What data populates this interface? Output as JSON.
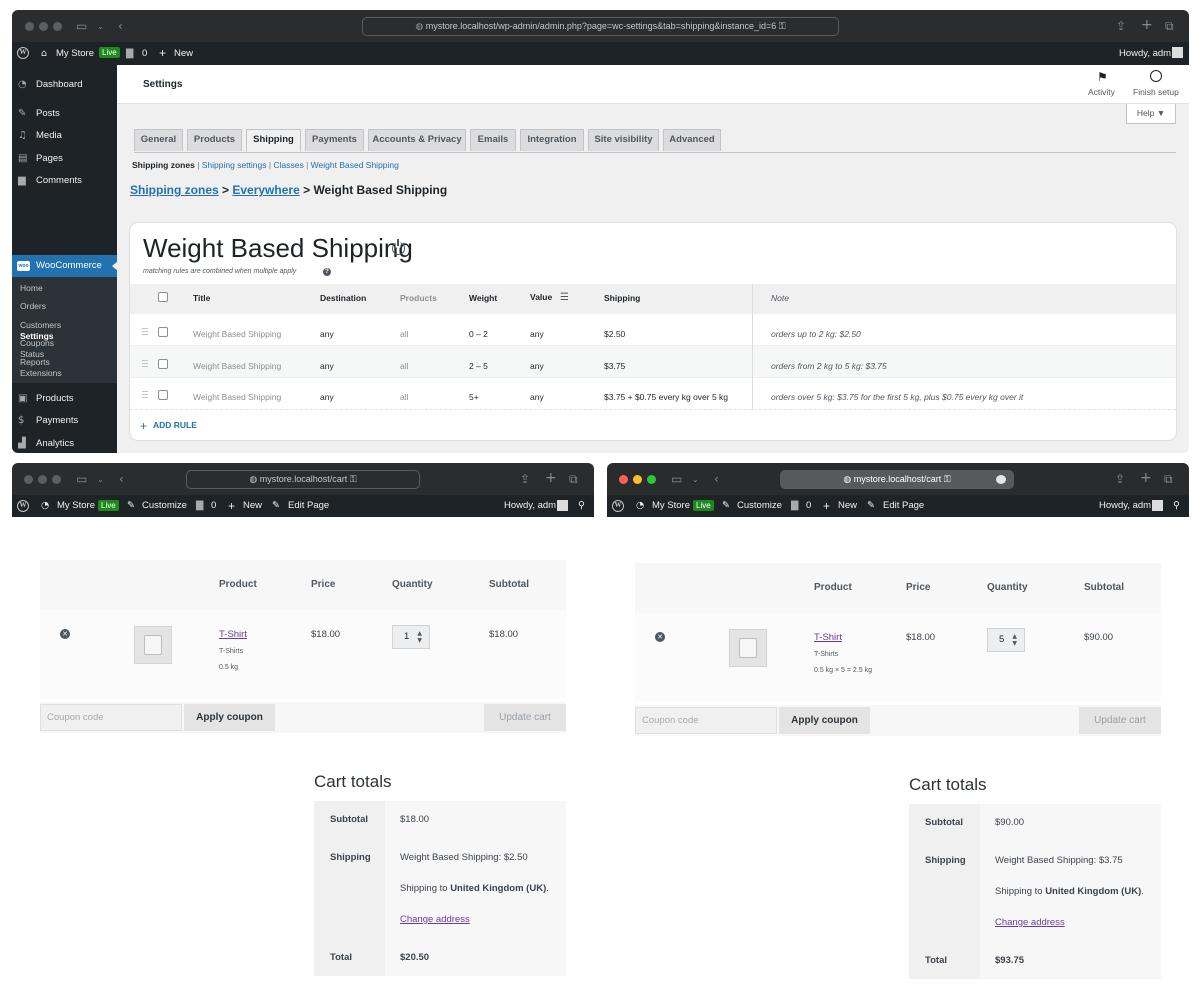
{
  "top": {
    "url": "mystore.localhost/wp-admin/admin.php?page=wc-settings&tab=shipping&instance_id=6",
    "admin_bar": {
      "site": "My Store",
      "live": "Live",
      "comments": "0",
      "new": "New",
      "howdy": "Howdy, adm"
    },
    "sidebar": {
      "items": [
        "Dashboard",
        "Posts",
        "Media",
        "Pages",
        "Comments"
      ],
      "woocommerce": "WooCommerce",
      "sub": [
        "Home",
        "Orders",
        "Customers",
        "Coupons",
        "Reports",
        "Settings",
        "Status",
        "Extensions"
      ],
      "bottom": [
        "Products",
        "Payments",
        "Analytics"
      ]
    },
    "header": {
      "title": "Settings",
      "activity": "Activity",
      "finish": "Finish setup",
      "help": "Help ▼"
    },
    "tabs": [
      "General",
      "Products",
      "Shipping",
      "Payments",
      "Accounts & Privacy",
      "Emails",
      "Integration",
      "Site visibility",
      "Advanced"
    ],
    "subnav": {
      "zones": "Shipping zones",
      "settings": "Shipping settings",
      "classes": "Classes",
      "wbs": "Weight Based Shipping"
    },
    "breadcrumb": {
      "zones": "Shipping zones",
      "everywhere": "Everywhere",
      "current": "Weight Based Shipping"
    },
    "panel": {
      "title": "Weight Based Shipping",
      "hint": "matching rules are combined when multiple apply",
      "columns": [
        "Title",
        "Destination",
        "Products",
        "Weight",
        "Value",
        "Shipping",
        "Note"
      ],
      "rows": [
        {
          "title": "Weight Based Shipping",
          "destination": "any",
          "products": "all",
          "weight": "0 – 2",
          "value": "any",
          "shipping": "$2.50",
          "note": "orders up to 2 kg: $2.50"
        },
        {
          "title": "Weight Based Shipping",
          "destination": "any",
          "products": "all",
          "weight": "2 – 5",
          "value": "any",
          "shipping": "$3.75",
          "note": "orders from 2 kg to 5 kg: $3.75"
        },
        {
          "title": "Weight Based Shipping",
          "destination": "any",
          "products": "all",
          "weight": "5+",
          "value": "any",
          "shipping": "$3.75 + $0.75 every kg over 5 kg",
          "note": "orders over 5 kg: $3.75 for the first 5 kg, plus $0.75 every kg over it"
        }
      ],
      "add_rule": "ADD RULE"
    }
  },
  "carts": [
    {
      "url": "mystore.localhost/cart",
      "bar": {
        "site": "My Store",
        "live": "Live",
        "customize": "Customize",
        "comments": "0",
        "new": "New",
        "edit": "Edit Page",
        "howdy": "Howdy, adm"
      },
      "headers": [
        "Product",
        "Price",
        "Quantity",
        "Subtotal"
      ],
      "product": "T-Shirt",
      "category": "T-Shirts",
      "weight": "0.5 kg",
      "price": "$18.00",
      "qty": "1",
      "subtotal": "$18.00",
      "coupon_placeholder": "Coupon code",
      "apply": "Apply coupon",
      "update": "Update cart",
      "totals_title": "Cart totals",
      "totals": {
        "subtotal_label": "Subtotal",
        "subtotal": "$18.00",
        "shipping_label": "Shipping",
        "method": "Weight Based Shipping: $2.50",
        "to_prefix": "Shipping to ",
        "to_country": "United Kingdom (UK)",
        "to_suffix": ".",
        "change": "Change address",
        "total_label": "Total",
        "total": "$20.50"
      }
    },
    {
      "url": "mystore.localhost/cart",
      "bar": {
        "site": "My Store",
        "live": "Live",
        "customize": "Customize",
        "comments": "0",
        "new": "New",
        "edit": "Edit Page",
        "howdy": "Howdy, adm"
      },
      "headers": [
        "Product",
        "Price",
        "Quantity",
        "Subtotal"
      ],
      "product": "T-Shirt",
      "category": "T-Shirts",
      "weight": "0.5 kg × 5 = 2.5 kg",
      "price": "$18.00",
      "qty": "5",
      "subtotal": "$90.00",
      "coupon_placeholder": "Coupon code",
      "apply": "Apply coupon",
      "update": "Update cart",
      "totals_title": "Cart totals",
      "totals": {
        "subtotal_label": "Subtotal",
        "subtotal": "$90.00",
        "shipping_label": "Shipping",
        "method": "Weight Based Shipping: $3.75",
        "to_prefix": "Shipping to ",
        "to_country": "United Kingdom (UK)",
        "to_suffix": ".",
        "change": "Change address",
        "total_label": "Total",
        "total": "$93.75"
      }
    }
  ],
  "colors": {
    "admin_dark": "#1d2327",
    "accent": "#2271b1",
    "live": "#1e8a1e",
    "link_visited": "#6b3ba0"
  }
}
